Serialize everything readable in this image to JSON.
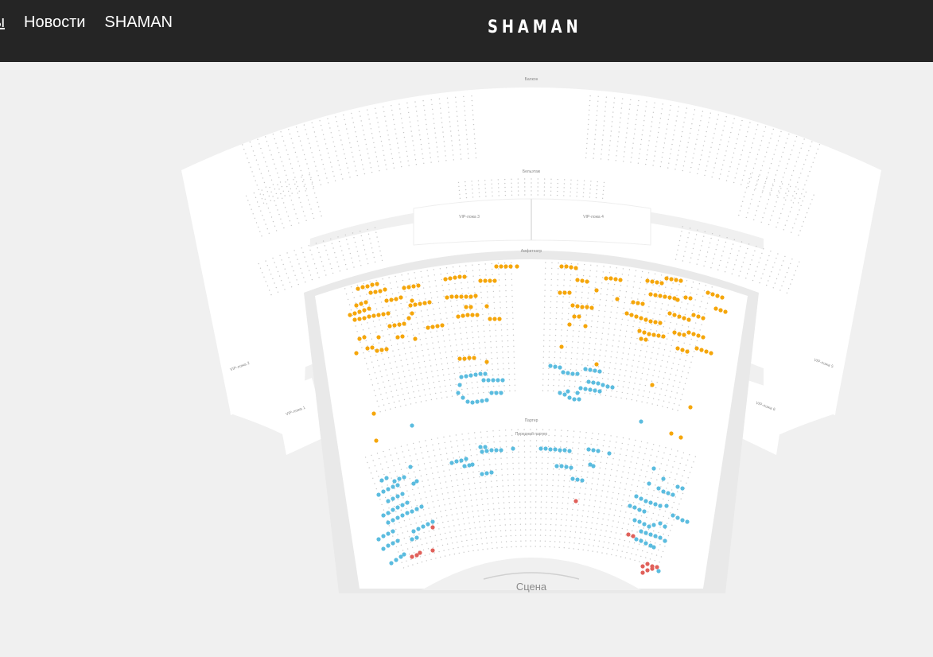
{
  "header": {
    "nav_items": [
      {
        "label": "Концерты"
      },
      {
        "label": "Новости"
      },
      {
        "label": "SHAMAN"
      }
    ],
    "logo": "SHAMAN"
  },
  "hall": {
    "stage_label": "Сцена",
    "sections": {
      "balcony": "Балкон",
      "mezzanine": "Бельэтаж",
      "amphitheatre": "Амфитеатр",
      "parterre": "Партер",
      "parterre_front": "Передний партер",
      "vip_box_1": "VIP-ложа 1",
      "vip_box_2": "VIP-ложа 2",
      "vip_box_3": "VIP-ложа 3",
      "vip_box_4": "VIP-ложа 4",
      "vip_box_5": "VIP-ложа 5",
      "vip_box_6": "VIP-ложа 6"
    },
    "colors": {
      "available_orange": "#f5a60a",
      "available_blue": "#5bbcdf",
      "available_red": "#e0605a",
      "unavailable": "#c6c6c6",
      "floor": "#ffffff",
      "background": "#f0f0f0"
    }
  }
}
